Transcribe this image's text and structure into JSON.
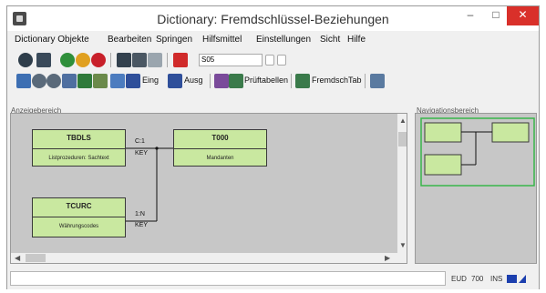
{
  "window": {
    "title": "Dictionary: Fremdschlüssel-Beziehungen",
    "minimize": "–",
    "maximize": "□",
    "close": "✕"
  },
  "menu": [
    "Dictionary Objekte",
    "Bearbeiten",
    "Springen",
    "Hilfsmittel",
    "Einstellungen",
    "Sicht",
    "Hilfe"
  ],
  "toolbar1": {
    "command_field": "S05"
  },
  "toolbar2": {
    "ein_label": "Eing",
    "ausg_label": "Ausg",
    "pruef_label": "Prüftabellen",
    "fremd_label": "FremdschTab"
  },
  "panels": {
    "work_label": "Anzeigebereich",
    "nav_label": "Navigationsbereich"
  },
  "tables": [
    {
      "name": "TBDLS",
      "desc": "Listprozeduren: Sachtext"
    },
    {
      "name": "T000",
      "desc": "Mandanten"
    },
    {
      "name": "TCURC",
      "desc": "Währungscodes"
    }
  ],
  "connections": [
    {
      "top": "C:1",
      "bottom": "KEY"
    },
    {
      "top": "1:N",
      "bottom": "KEY"
    }
  ],
  "status": {
    "system": "EUD",
    "client": "700",
    "user": "INS"
  },
  "colors": {
    "table_fill": "#c9e8a0",
    "canvas": "#c7c7c7",
    "close_button": "#d9302a",
    "nav_frame": "#39b54a"
  }
}
